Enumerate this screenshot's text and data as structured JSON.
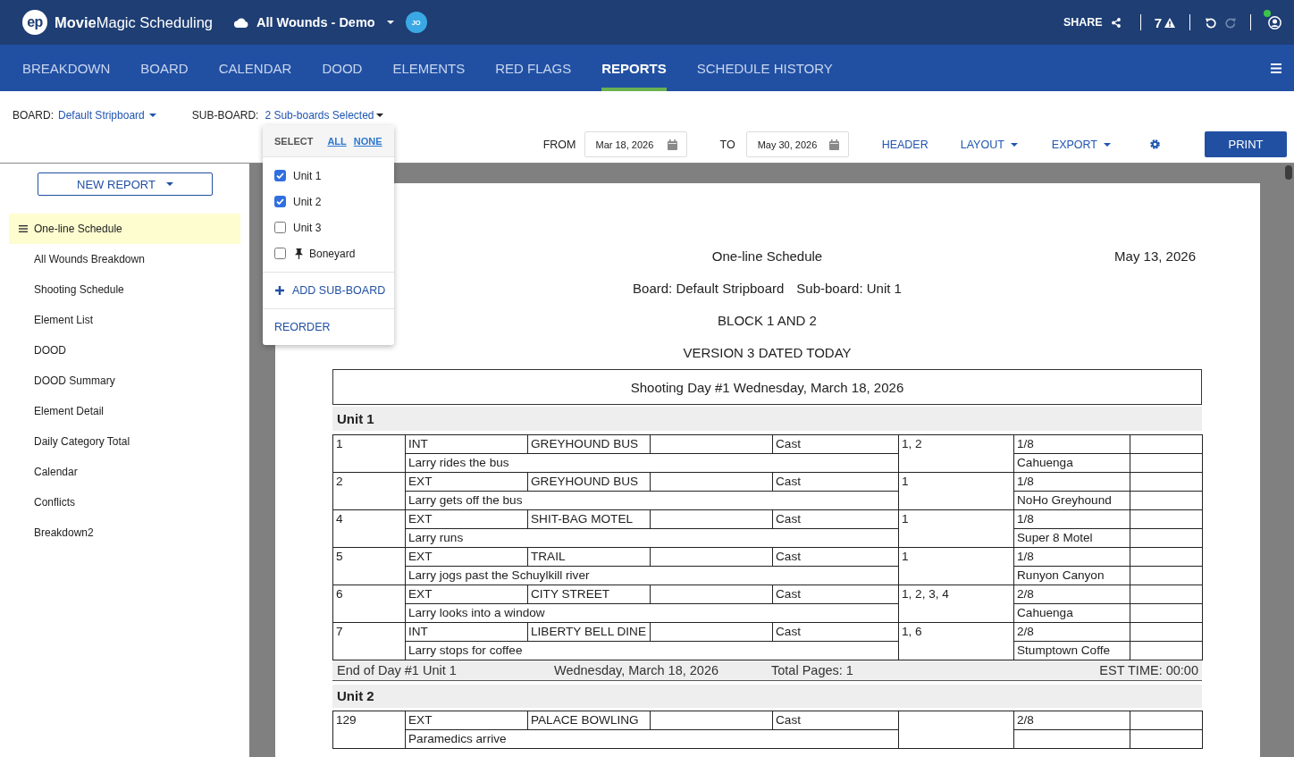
{
  "top_bar": {
    "logo": "ep",
    "app_name": "**Movie**Magic Scheduling",
    "project": "All Wounds - Demo",
    "user_initials": "JO",
    "share": "SHARE",
    "warning_count": "7",
    "undo": {
      "disabled": false
    },
    "redo": {
      "disabled": true
    },
    "online": true
  },
  "nav": {
    "tabs": [
      {
        "label": "BREAKDOWN",
        "selected": false
      },
      {
        "label": "BOARD",
        "selected": false
      },
      {
        "label": "CALENDAR",
        "selected": false
      },
      {
        "label": "DOOD",
        "selected": false
      },
      {
        "label": "ELEMENTS",
        "selected": false
      },
      {
        "label": "RED FLAGS",
        "selected": false
      },
      {
        "label": "REPORTS",
        "selected": true
      },
      {
        "label": "SCHEDULE HISTORY",
        "selected": false
      }
    ]
  },
  "board_bar": {
    "board_label": "BOARD:",
    "board": "Default Stripboard",
    "subboard_label": "SUB-BOARD:",
    "subboard": "2 Sub-boards Selected",
    "from_label": "FROM",
    "from_date": "Mar 18, 2026",
    "to_label": "TO",
    "to_date": "May 30, 2026",
    "header": "HEADER",
    "layout": "LAYOUT",
    "export": "EXPORT",
    "print": "PRINT"
  },
  "subboard_menu": {
    "select_label": "SELECT",
    "all": "ALL",
    "none": "NONE",
    "items": [
      {
        "label": "Unit 1",
        "checked": true,
        "pinned": false
      },
      {
        "label": "Unit 2",
        "checked": true,
        "pinned": false
      },
      {
        "label": "Unit 3",
        "checked": false,
        "pinned": false
      },
      {
        "label": "Boneyard",
        "checked": false,
        "pinned": true
      }
    ],
    "add": "ADD SUB-BOARD",
    "reorder": "REORDER"
  },
  "sidebar": {
    "new_report": "NEW REPORT",
    "items": [
      {
        "label": "One-line Schedule",
        "selected": true
      },
      {
        "label": "All Wounds Breakdown",
        "selected": false
      },
      {
        "label": "Shooting Schedule",
        "selected": false
      },
      {
        "label": "Element List",
        "selected": false
      },
      {
        "label": "DOOD",
        "selected": false
      },
      {
        "label": "DOOD Summary",
        "selected": false
      },
      {
        "label": "Element Detail",
        "selected": false
      },
      {
        "label": "Daily Category Total",
        "selected": false
      },
      {
        "label": "Calendar",
        "selected": false
      },
      {
        "label": "Conflicts",
        "selected": false
      },
      {
        "label": "Breakdown2",
        "selected": false
      }
    ]
  },
  "report": {
    "title": "One-line Schedule",
    "date": "May 13, 2026",
    "board_line": "Board: Default Stripboard",
    "subboard_line": "Sub-board: Unit 1",
    "block": "BLOCK 1 AND 2",
    "version": "VERSION 3 DATED TODAY",
    "day_heading": "Shooting Day #1 Wednesday, March 18, 2026",
    "units": [
      {
        "name": "Unit 1",
        "scenes": [
          {
            "number": "1",
            "int_ext": "INT",
            "set": "GREYHOUND BUS",
            "category": "Cast",
            "cast_ids": "1, 2",
            "pages": "1/8",
            "description": "Larry rides the bus",
            "location": "Cahuenga"
          },
          {
            "number": "2",
            "int_ext": "EXT",
            "set": "GREYHOUND BUS",
            "category": "Cast",
            "cast_ids": "1",
            "pages": "1/8",
            "description": "Larry gets off the bus",
            "location": "NoHo Greyhound"
          },
          {
            "number": "4",
            "int_ext": "EXT",
            "set": "SHIT-BAG MOTEL",
            "category": "Cast",
            "cast_ids": "1",
            "pages": "1/8",
            "description": "Larry runs",
            "location": "Super 8 Motel"
          },
          {
            "number": "5",
            "int_ext": "EXT",
            "set": "TRAIL",
            "category": "Cast",
            "cast_ids": "1",
            "pages": "1/8",
            "description": "Larry jogs past the Schuylkill river",
            "location": "Runyon Canyon"
          },
          {
            "number": "6",
            "int_ext": "EXT",
            "set": "CITY STREET",
            "category": "Cast",
            "cast_ids": "1, 2, 3, 4",
            "pages": "2/8",
            "description": "Larry looks into a window",
            "location": "Cahuenga"
          },
          {
            "number": "7",
            "int_ext": "INT",
            "set": "LIBERTY BELL DINE",
            "category": "Cast",
            "cast_ids": "1, 6",
            "pages": "2/8",
            "description": "Larry stops for coffee",
            "location": "Stumptown Coffe"
          }
        ],
        "footer": {
          "end_of_day": "End of Day #1 Unit 1",
          "date": "Wednesday, March 18, 2026",
          "total_pages": "Total Pages: 1",
          "est_time": "EST TIME: 00:00"
        }
      },
      {
        "name": "Unit 2",
        "scenes": [
          {
            "number": "129",
            "int_ext": "EXT",
            "set": "PALACE BOWLING",
            "category": "Cast",
            "pages": "2/8",
            "description": "Paramedics arrive"
          }
        ]
      }
    ]
  }
}
